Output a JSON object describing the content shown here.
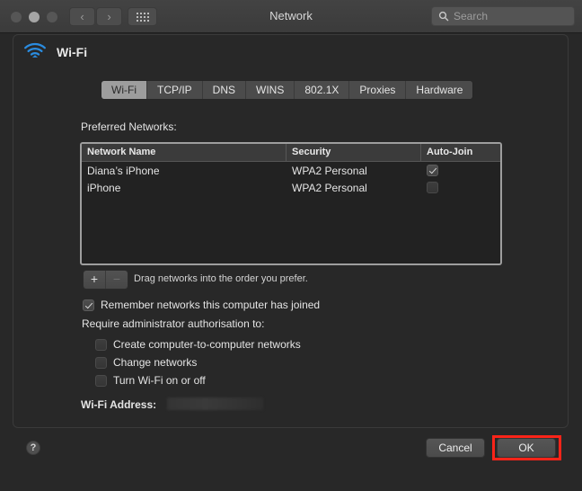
{
  "window": {
    "title": "Network",
    "traffic_lights": [
      "close",
      "minimize",
      "maximize"
    ],
    "nav_back": "‹",
    "nav_forward": "›",
    "grid_button": "all-preferences"
  },
  "search": {
    "placeholder": "Search",
    "value": "",
    "icon": "search-icon"
  },
  "header": {
    "service_name": "Wi-Fi",
    "icon": "wifi-icon",
    "icon_color": "#2a8ce0"
  },
  "tabs": [
    {
      "label": "Wi-Fi",
      "active": true
    },
    {
      "label": "TCP/IP",
      "active": false
    },
    {
      "label": "DNS",
      "active": false
    },
    {
      "label": "WINS",
      "active": false
    },
    {
      "label": "802.1X",
      "active": false
    },
    {
      "label": "Proxies",
      "active": false
    },
    {
      "label": "Hardware",
      "active": false
    }
  ],
  "preferred_networks": {
    "label": "Preferred Networks:",
    "columns": [
      "Network Name",
      "Security",
      "Auto-Join"
    ],
    "rows": [
      {
        "name": "Diana’s iPhone",
        "security": "WPA2 Personal",
        "auto_join": true
      },
      {
        "name": "iPhone",
        "security": "WPA2 Personal",
        "auto_join": false
      }
    ],
    "add_label": "+",
    "remove_label": "−",
    "remove_disabled": true,
    "drag_hint": "Drag networks into the order you prefer."
  },
  "options": {
    "remember": {
      "label": "Remember networks this computer has joined",
      "checked": true
    },
    "require_label": "Require administrator authorisation to:",
    "require_items": [
      {
        "label": "Create computer-to-computer networks",
        "checked": false
      },
      {
        "label": "Change networks",
        "checked": false
      },
      {
        "label": "Turn Wi-Fi on or off",
        "checked": false
      }
    ]
  },
  "wifi_address": {
    "label": "Wi-Fi Address:",
    "value": ""
  },
  "footer": {
    "help_label": "?",
    "cancel_label": "Cancel",
    "ok_label": "OK",
    "highlight_color": "#fb2419"
  }
}
